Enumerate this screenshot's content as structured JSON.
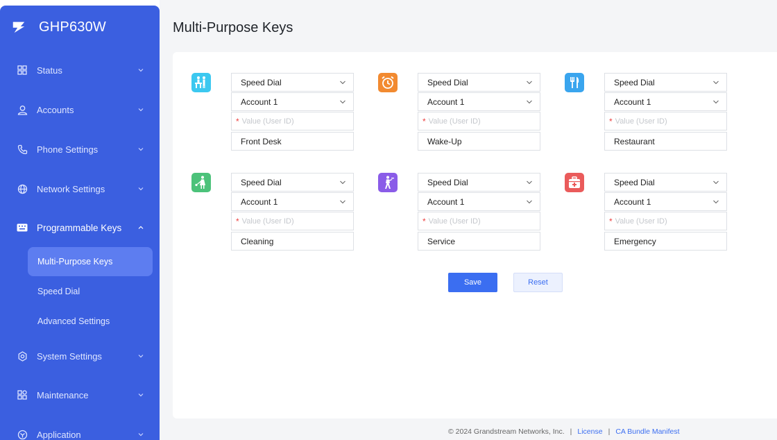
{
  "app": {
    "name": "GHP630W",
    "page_title": "Multi-Purpose Keys"
  },
  "sidebar": {
    "items": [
      {
        "label": "Status",
        "icon": "grid-icon"
      },
      {
        "label": "Accounts",
        "icon": "user-icon"
      },
      {
        "label": "Phone Settings",
        "icon": "phone-icon"
      },
      {
        "label": "Network Settings",
        "icon": "globe-icon"
      },
      {
        "label": "Programmable Keys",
        "icon": "keyboard-icon",
        "expanded": true
      },
      {
        "label": "System Settings",
        "icon": "gear-icon"
      },
      {
        "label": "Maintenance",
        "icon": "grid-plus-icon"
      },
      {
        "label": "Application",
        "icon": "cube-icon"
      }
    ],
    "subitems": [
      {
        "label": "Multi-Purpose Keys",
        "active": true
      },
      {
        "label": "Speed Dial"
      },
      {
        "label": "Advanced Settings"
      }
    ]
  },
  "keys": [
    {
      "icon": "front-desk-icon",
      "color": "#3cc8f0",
      "mode": "Speed Dial",
      "account": "Account 1",
      "value_placeholder": "Value (User ID)",
      "name": "Front Desk"
    },
    {
      "icon": "alarm-clock-icon",
      "color": "#f28a30",
      "mode": "Speed Dial",
      "account": "Account 1",
      "value_placeholder": "Value (User ID)",
      "name": "Wake-Up"
    },
    {
      "icon": "restaurant-icon",
      "color": "#3aa5ee",
      "mode": "Speed Dial",
      "account": "Account 1",
      "value_placeholder": "Value (User ID)",
      "name": "Restaurant"
    },
    {
      "icon": "cleaning-icon",
      "color": "#4cc27a",
      "mode": "Speed Dial",
      "account": "Account 1",
      "value_placeholder": "Value (User ID)",
      "name": "Cleaning"
    },
    {
      "icon": "service-icon",
      "color": "#8a5ce8",
      "mode": "Speed Dial",
      "account": "Account 1",
      "value_placeholder": "Value (User ID)",
      "name": "Service"
    },
    {
      "icon": "first-aid-icon",
      "color": "#ea5b5b",
      "mode": "Speed Dial",
      "account": "Account 1",
      "value_placeholder": "Value (User ID)",
      "name": "Emergency"
    }
  ],
  "buttons": {
    "save": "Save",
    "reset": "Reset"
  },
  "footer": {
    "copyright": "© 2024 Grandstream Networks, Inc.",
    "separator": "|",
    "license": "License",
    "ca_bundle": "CA Bundle Manifest"
  }
}
